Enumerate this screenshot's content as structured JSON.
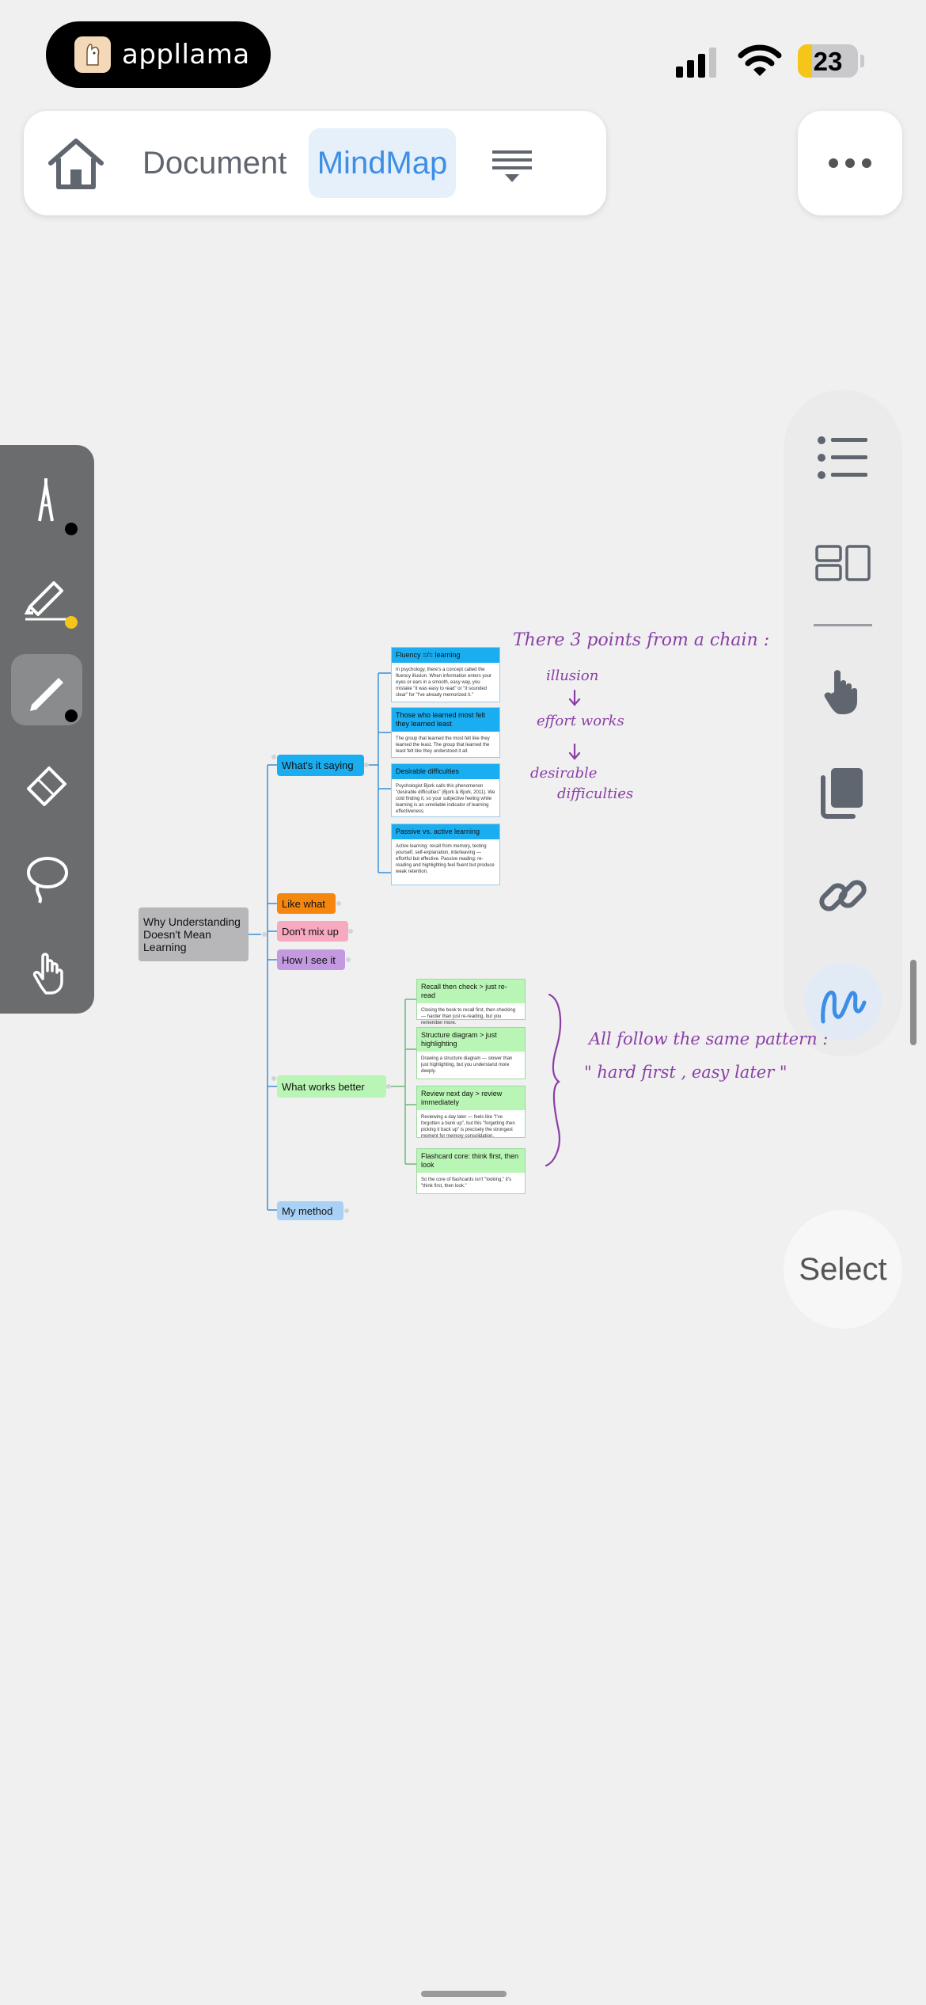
{
  "status_bar": {
    "brand": "appllama",
    "battery": "23"
  },
  "toolbar": {
    "tabs": [
      {
        "label": "Document"
      },
      {
        "label": "MindMap"
      }
    ]
  },
  "mindmap": {
    "root": "Why Understanding Doesn't Mean Learning",
    "branches": {
      "saying": "What's it saying",
      "like": "Like what",
      "mix": "Don't mix up",
      "see": "How I see it",
      "works": "What works better",
      "method": "My method"
    },
    "saying_cards": [
      {
        "title": "Fluency =/= learning",
        "body": "In psychology, there's a concept called the fluency illusion. When information enters your eyes or ears in a smooth, easy way, you mistake \"it was easy to read\" or \"it sounded clear\" for \"I've already memorized it.\""
      },
      {
        "title": "Those who learned most felt they learned least",
        "body": "The group that learned the most felt like they learned the least. The group that learned the least felt like they understood it all."
      },
      {
        "title": "Desirable difficulties",
        "body": "Psychologist Bjork calls this phenomenon \"desirable difficulties\" (Bjork & Bjork, 2011). We cold finding it, so your subjective feeling while learning is an unreliable indicator of learning effectiveness."
      },
      {
        "title": "Passive vs. active learning",
        "body": "Active learning: recall from memory, testing yourself, self-explanation, interleaving — effortful but effective. Passive reading: re-reading and highlighting feel fluent but produce weak retention."
      }
    ],
    "works_cards": [
      {
        "title": "Recall then check > just re-read",
        "body": "Closing the book to recall first, then checking — harder than just re-reading, but you remember more."
      },
      {
        "title": "Structure diagram > just highlighting",
        "body": "Drawing a structure diagram — slower than just highlighting, but you understand more deeply."
      },
      {
        "title": "Review next day > review immediately",
        "body": "Reviewing a day later — feels like \"I've forgotten a bunk up\", but this \"forgetting then picking it back up\" is precisely the strongest moment for memory consolidation."
      },
      {
        "title": "Flashcard core: think first, then look",
        "body": "So the core of flashcards isn't \"looking,\" it's \"think first, then look.\""
      }
    ],
    "handwriting": {
      "chain_title": "There 3 points from a chain :",
      "chain_1": "illusion",
      "chain_2": "effort works",
      "chain_3": "desirable",
      "chain_4": "difficulties",
      "pattern_1": "All follow the same pattern :",
      "pattern_2": "\" hard first , easy later \""
    }
  },
  "right_panel": {
    "select_label": "Select"
  },
  "colors": {
    "accent": "#3d8ee6",
    "ink": "#8a3fa6",
    "card_header": "#1aaef0",
    "green_header": "#b9f5b4",
    "orange": "#f5870f",
    "pink": "#f7a9c0",
    "purple": "#c39ae0",
    "blue_node": "#a9d0f5",
    "root": "#b7b7b9"
  }
}
